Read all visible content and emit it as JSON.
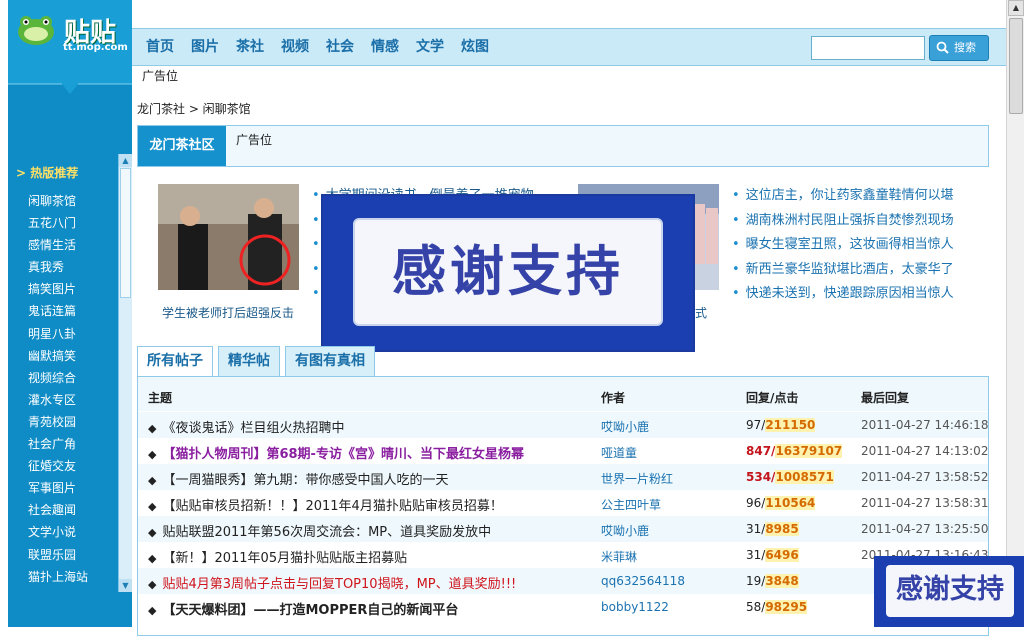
{
  "logo": {
    "text": "贴贴",
    "url": "tt.mop.com"
  },
  "sidebar": {
    "hot_title": "> 热版推荐",
    "items": [
      "闲聊茶馆",
      "五花八门",
      "感情生活",
      "真我秀",
      "搞笑图片",
      "鬼话连篇",
      "明星八卦",
      "幽默搞笑",
      "视频综合",
      "灌水专区",
      "青苑校园",
      "社会广角",
      "征婚交友",
      "军事图片",
      "社会趣闻",
      "文学小说",
      "联盟乐园",
      "猫扑上海站"
    ]
  },
  "nav": {
    "items": [
      "首页",
      "图片",
      "茶社",
      "视频",
      "社会",
      "情感",
      "文学",
      "炫图"
    ],
    "search_placeholder": "",
    "search_button": "搜索"
  },
  "ad_top": "广告位",
  "breadcrumb": "龙门茶社 > 闲聊茶馆",
  "community": {
    "title": "龙门茶社区",
    "ad": "广告位"
  },
  "news": {
    "photo1_caption": "学生被老师打后超强反击",
    "photo2_caption": "式",
    "left_items": [
      "大学期间没读书，倒是养了一堆宠物",
      "",
      "",
      "",
      ""
    ],
    "right_items": [
      "这位店主，你让药家鑫童鞋情何以堪",
      "湖南株洲村民阻止强拆自焚惨烈现场",
      "曝女生寝室丑照，这妆画得相当惊人",
      "新西兰豪华监狱堪比酒店，太豪华了",
      "快递未送到，快递跟踪原因相当惊人"
    ]
  },
  "overlay": {
    "text": "感谢支持",
    "corner_text": "感谢支持"
  },
  "tabs": [
    "所有帖子",
    "精华帖",
    "有图有真相"
  ],
  "table": {
    "headers": {
      "title": "主题",
      "author": "作者",
      "reply": "回复/点击",
      "last": "最后回复"
    },
    "rows": [
      {
        "title": "《夜谈鬼话》栏目组火热招聘中",
        "author": "哎呦小鹿",
        "reply": "97/",
        "click": "211150",
        "last": "2011-04-27 14:46:18"
      },
      {
        "title": "【猫扑人物周刊】第68期-专访《宫》晴川、当下最红女星杨幂",
        "author": "哑道童",
        "reply": "847/",
        "click": "16379107",
        "last": "2011-04-27 14:13:02"
      },
      {
        "title": "【一周猫眼秀】第九期：带你感受中国人吃的一天",
        "author": "世界一片粉红",
        "reply": "534/",
        "click": "1008571",
        "last": "2011-04-27 13:58:52"
      },
      {
        "title": "【贴贴审核员招新！！】2011年4月猫扑贴贴审核员招募！",
        "author": "公主四叶草",
        "reply": "96/",
        "click": "110564",
        "last": "2011-04-27 13:58:31"
      },
      {
        "title": "贴贴联盟2011年第56次周交流会：MP、道具奖励发放中",
        "author": "哎呦小鹿",
        "reply": "31/",
        "click": "8985",
        "last": "2011-04-27 13:25:50"
      },
      {
        "title": "【新！】2011年05月猫扑贴贴版主招募贴",
        "author": "米菲琳",
        "reply": "31/",
        "click": "6496",
        "last": "2011-04-27 13:16:43"
      },
      {
        "title": "贴贴4月第3周帖子点击与回复TOP10揭晓，MP、道具奖励!!!",
        "author": "qq632564118",
        "reply": "19/",
        "click": "3848",
        "last": ""
      },
      {
        "title": "【天天爆料团】——打造MOPPER自己的新闻平台",
        "author": "bobby1122",
        "reply": "58/",
        "click": "98295",
        "last": ""
      }
    ]
  }
}
